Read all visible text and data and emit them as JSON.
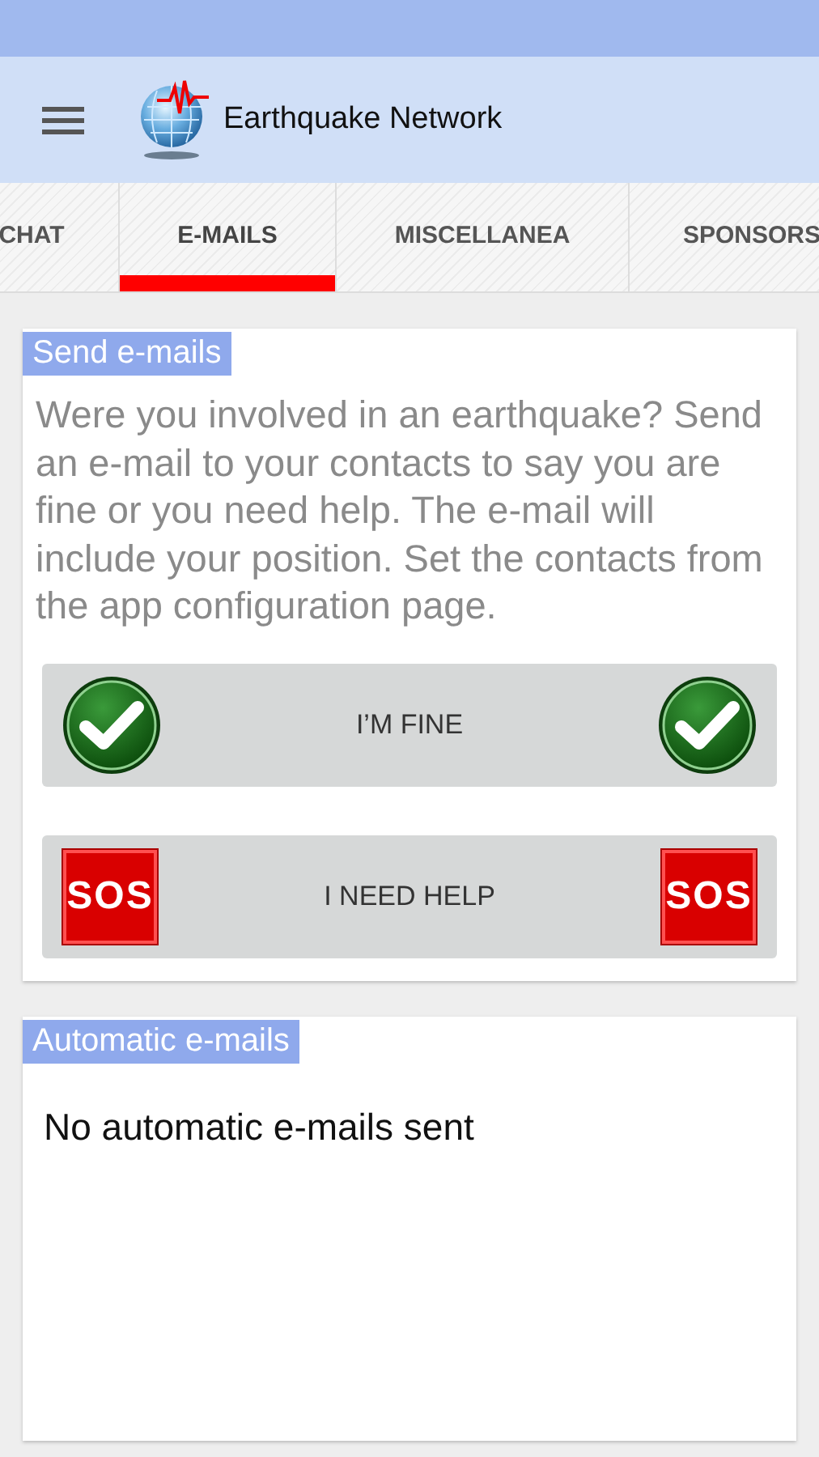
{
  "toolbar": {
    "title": "Earthquake Network"
  },
  "tabs": [
    {
      "label": "CHAT",
      "selected": false
    },
    {
      "label": "E-MAILS",
      "selected": true
    },
    {
      "label": "MISCELLANEA",
      "selected": false
    },
    {
      "label": "SPONSORS",
      "selected": false
    }
  ],
  "cards": [
    {
      "heading": "Send e-mails",
      "text": "Were you involved in an earthquake? Send an e-mail to your contacts to say you are fine or you need help. The e-mail will include your position. Set the contacts from the app configuration page.",
      "buttons": [
        {
          "label": "I’M FINE",
          "kind": "check"
        },
        {
          "label": "I NEED HELP",
          "kind": "sos",
          "badges": [
            "SOS",
            "SOS"
          ]
        }
      ]
    },
    {
      "heading": "Automatic e-mails",
      "message": "No automatic e-mails sent"
    }
  ]
}
